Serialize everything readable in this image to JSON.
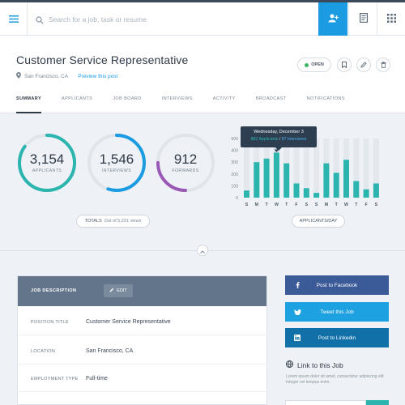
{
  "topbar": {
    "search_placeholder": "Search for a job, task or resume"
  },
  "icons": [
    "menu-icon",
    "search-icon",
    "add-user-icon",
    "document-icon",
    "grid-icon",
    "location-pin-icon",
    "bookmark-icon",
    "edit-icon",
    "trash-icon",
    "pencil-icon",
    "facebook-icon",
    "twitter-icon",
    "linkedin-icon",
    "link-icon",
    "chevron-up-icon"
  ],
  "colors": {
    "accent": "#1b9ce2",
    "teal": "#2bb5ae",
    "purple": "#9b59b6",
    "status_green": "#3fb565",
    "facebook": "#3b5a98",
    "twitter": "#1ea1e0",
    "linkedin": "#1170a8"
  },
  "header": {
    "title": "Customer Service Representative",
    "location": "San Francisco, CA",
    "preview_link": "Preview this post",
    "status_label": "OPEN",
    "tabs": [
      "SUMMARY",
      "APPLICANTS",
      "JOB BOARD",
      "INTERVIEWS",
      "ACTIVITY",
      "BROADCAST",
      "NOTIFICATIONS"
    ]
  },
  "stats": {
    "applicants": {
      "value": "3,154",
      "label": "APPLICANTS",
      "fraction": 0.85
    },
    "interviews": {
      "value": "1,546",
      "label": "INTERVIEWS",
      "fraction": 0.55
    },
    "forwards": {
      "value": "912",
      "label": "FORWARDS",
      "fraction": 0.25
    },
    "totals_label": "TOTALS",
    "totals_views": "Out of 5,231 views"
  },
  "chart_data": {
    "type": "bar",
    "categories": [
      "S",
      "M",
      "T",
      "W",
      "T",
      "F",
      "S",
      "S",
      "M",
      "T",
      "W",
      "T",
      "F",
      "S"
    ],
    "series": [
      {
        "name": "Applicants",
        "values": [
          60,
          300,
          330,
          190,
          290,
          120,
          80,
          40,
          290,
          210,
          320,
          140,
          70,
          120
        ]
      },
      {
        "name": "Interviews",
        "values": [
          0,
          0,
          0,
          380,
          0,
          0,
          0,
          0,
          0,
          0,
          0,
          0,
          0,
          0
        ]
      }
    ],
    "background_max": 500,
    "ylim": [
      0,
      500
    ],
    "yticks": [
      0,
      100,
      200,
      300,
      400,
      500
    ],
    "ylabel": "",
    "xlabel": "APPLICANTS/DAY",
    "highlight_index": 3,
    "tooltip": {
      "title": "Wednesday, December 3",
      "applicants_text": "882 Applicants",
      "separator": "/",
      "interviews_text": "87 Interviews"
    },
    "grid": false
  },
  "job_description": {
    "title": "JOB DESCRIPTION",
    "edit_label": "EDIT",
    "rows": [
      {
        "key": "POSITION TITLE",
        "value": "Customer Service Representative"
      },
      {
        "key": "LOCATION",
        "value": "San Francisco, CA"
      },
      {
        "key": "EMPLOYMENT TYPE",
        "value": "Full-time"
      }
    ]
  },
  "share": {
    "facebook_label": "Post to Facebook",
    "twitter_label": "Tweet this Job",
    "linkedin_label": "Post to Linkedin",
    "link_title": "Link to this Job",
    "link_desc": "Lorem ipsum dolor sit amet, consectetur adipiscing elit. Integer vel tempus enim."
  }
}
